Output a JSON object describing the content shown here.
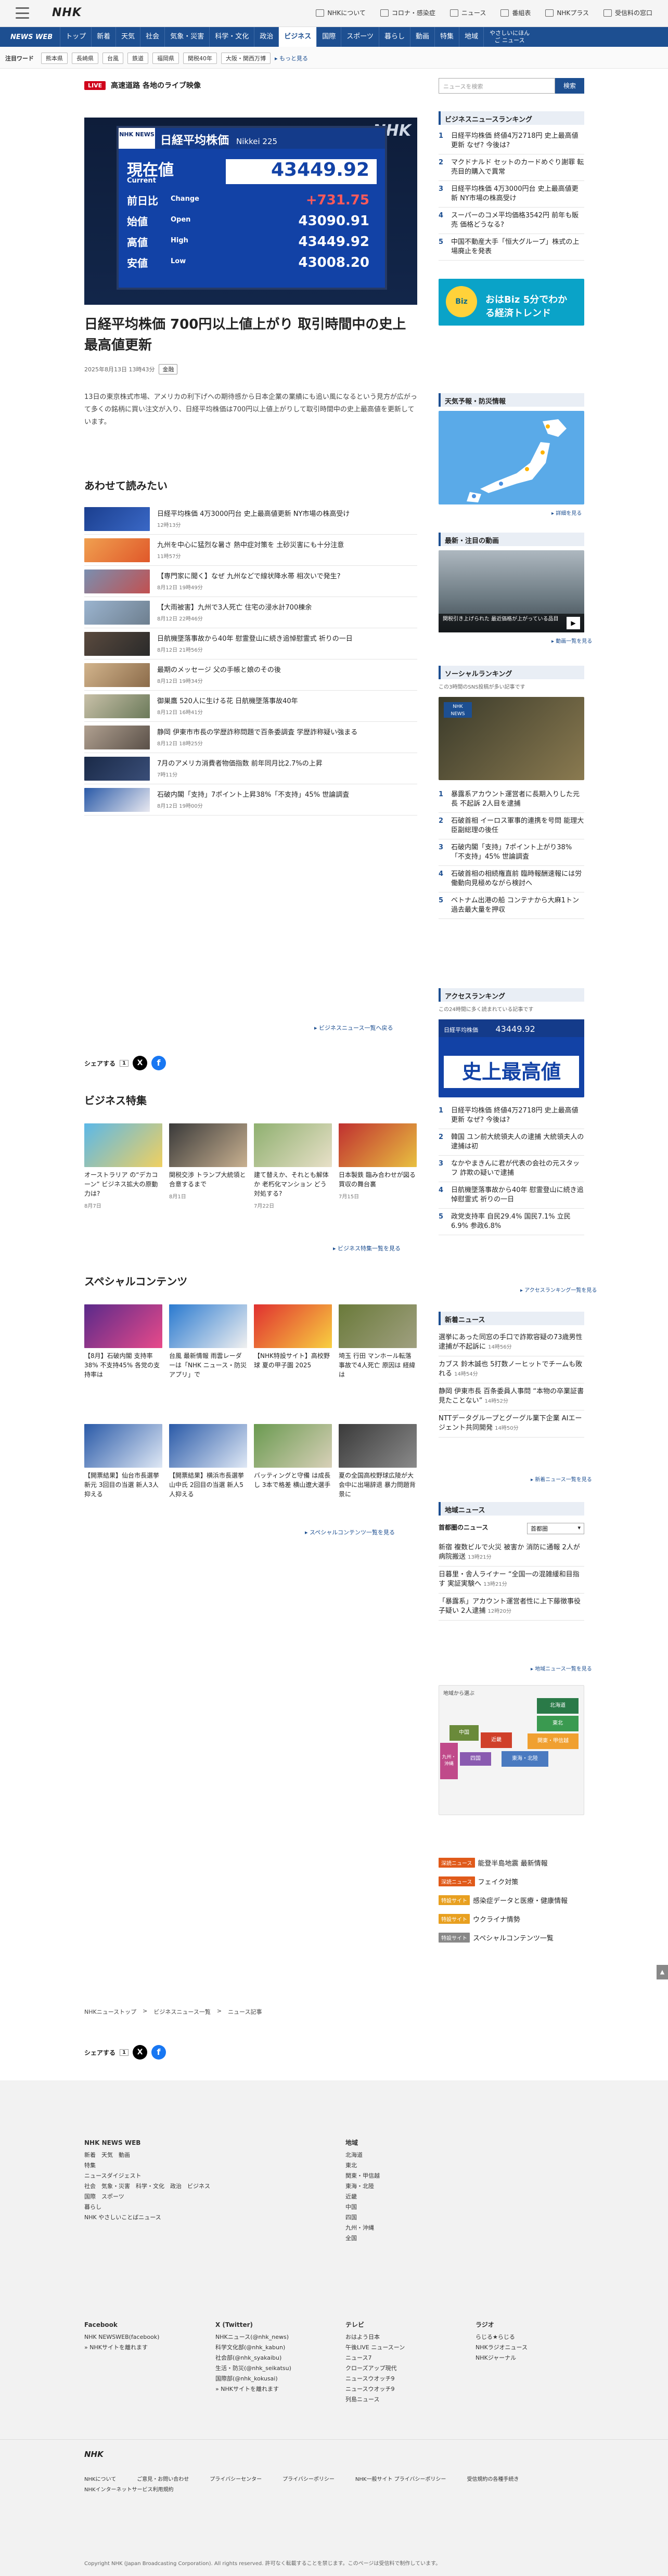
{
  "header": {
    "logo": "NHK",
    "links": [
      "NHKについて",
      "コロナ・感染症",
      "ニュース",
      "番組表",
      "NHKプラス",
      "受信料の窓口"
    ]
  },
  "nav": {
    "brand": "NEWS WEB",
    "items": [
      "トップ",
      "新着",
      "天気",
      "社会",
      "気象・災害",
      "科学・文化",
      "政治",
      "ビジネス",
      "国際",
      "スポーツ",
      "暮らし",
      "動画",
      "特集",
      "地域"
    ],
    "easy": "やさしいにほんご ニュース",
    "active": "ビジネス"
  },
  "attention": {
    "label": "注目ワード",
    "chips": [
      "熊本県",
      "長崎県",
      "台風",
      "鉄道",
      "福岡県",
      "関税40年",
      "大阪・関西万博"
    ],
    "more": "▸ もっと見る"
  },
  "live": {
    "badge": "LIVE",
    "text": "高速道路 各地のライブ映像"
  },
  "hero": {
    "box": "NHK NEWS",
    "title": "日経平均株価",
    "subtitle": "Nikkei 225",
    "watermark": "NHK",
    "rows": [
      {
        "ja": "現在値",
        "en": "Current",
        "val": "43449.92"
      },
      {
        "ja": "前日比",
        "en": "Change",
        "val": "+731.75"
      },
      {
        "ja": "始値",
        "en": "Open",
        "val": "43090.91"
      },
      {
        "ja": "高値",
        "en": "High",
        "val": "43449.92"
      },
      {
        "ja": "安値",
        "en": "Low",
        "val": "43008.20"
      }
    ]
  },
  "article": {
    "headline": "日経平均株価 700円以上値上がり 取引時間中の史上最高値更新",
    "date": "2025年8月13日 13時43分",
    "tag": "金融",
    "lead": "13日の東京株式市場、アメリカの利下げへの期待感から日本企業の業績にも追い風になるという見方が広がって多くの銘柄に買い注文が入り、日経平均株価は700円以上値上がりして取引時間中の史上最高値を更新しています。"
  },
  "related": {
    "title": "あわせて読みたい",
    "items": [
      {
        "t": "日経平均株価 4万3000円台 史上最高値更新 NY市場の株高受け",
        "d": "12時13分"
      },
      {
        "t": "九州を中心に猛烈な暑さ 熱中症対策を 土砂災害にも十分注意",
        "d": "11時57分"
      },
      {
        "t": "【専門家に聞く】なぜ 九州などで線状降水帯 相次いで発生?",
        "d": "8月12日 19時49分"
      },
      {
        "t": "【大雨被害】九州で3人死亡 住宅の浸水計700棟余",
        "d": "8月12日 22時46分"
      },
      {
        "t": "日航機墜落事故から40年 慰霊登山に続き追悼慰霊式 祈りの一日",
        "d": "8月12日 21時56分"
      },
      {
        "t": "最期のメッセージ 父の手帳と娘のその後",
        "d": "8月12日 19時34分"
      },
      {
        "t": "御巣鷹 520人に生ける花 日航機墜落事故40年",
        "d": "8月12日 16時41分"
      },
      {
        "t": "静岡 伊東市市長の学歴詐称問題で百条委調査 学歴詐称疑い強まる",
        "d": "8月12日 18時25分"
      },
      {
        "t": "7月のアメリカ消費者物価指数 前年同月比2.7%の上昇",
        "d": "7時11分"
      },
      {
        "t": "石破内閣「支持」7ポイント上昇38%「不支持」45% 世論調査",
        "d": "8月12日 19時00分"
      }
    ],
    "more": "▸ ビジネスニュース一覧へ戻る"
  },
  "share": {
    "label": "シェアする",
    "count": "1"
  },
  "feature": {
    "title": "ビジネス特集",
    "items": [
      {
        "t": "オーストラリア の“デカコーン” ビジネス拡大の原動力は?",
        "d": "8月7日"
      },
      {
        "t": "関税交渉 トランプ大統領と合意するまで",
        "d": "8月1日"
      },
      {
        "t": "建て替えか、それとも解体か 老朽化マンション どう対処する?",
        "d": "7月22日"
      },
      {
        "t": "日本製鉄 臨み合わせが図る買収の舞台裏",
        "d": "7月15日"
      }
    ],
    "more": "▸ ビジネス特集一覧を見る"
  },
  "special": {
    "title": "スペシャルコンテンツ",
    "items": [
      {
        "t": "【8月】石破内閣 支持率38% 不支持45% 各党の支持率は"
      },
      {
        "t": "台風 最新情報 雨雲レーダーは「NHK ニュース・防災アプリ」で"
      },
      {
        "t": "【NHK特設サイト】高校野球 夏の甲子園 2025"
      },
      {
        "t": "埼玉 行田 マンホール転落事故で4人死亡 原因は 経緯は"
      },
      {
        "t": "【開票結果】仙台市長選挙 新元 3回目の当選 新人3人抑える"
      },
      {
        "t": "【開票結果】横浜市長選挙 山中氏 2回目の当選 新人5人抑える"
      },
      {
        "t": "バッティングと守備 は成長し 3本で格差 横山遼大選手"
      },
      {
        "t": "夏の全国高校野球広陵が大会中に出場辞退 暴力問題背景に"
      }
    ],
    "more": "▸ スペシャルコンテンツ一覧を見る"
  },
  "search": {
    "placeholder": "ニュースを検索",
    "button": "検索"
  },
  "sidebar": {
    "ranking_title": "ビジネスニュースランキング",
    "ranking": [
      "日経平均株価 終値4万2718円 史上最高値更新 なぜ? 今後は?",
      "マクドナルド セットのカードめぐり謝罪 転売目的購入で異常",
      "日経平均株価 4万3000円台 史上最高値更新 NY市場の株高受け",
      "スーパーのコメ平均価格3542円 前年も販売 価格どうなる?",
      "中国不動産大手「恒大グループ」株式の上場廃止を発表"
    ],
    "biz_banner": "おはBiz 5分でわかる経済トレンド",
    "weather_title": "天気予報・防災情報",
    "weather_more": "▸ 詳細を見る",
    "video_title": "最新・注目の動画",
    "video_caption": "関税引き上げられた 最近価格が上がっている品目",
    "video_more": "▸ 動画一覧を見る",
    "social_title": "ソーシャルランキング",
    "social_sub": "この3時間のSNS投稿が多い記事です",
    "social": [
      "暴露系アカウント運営者に長期入りした元長 不起訴 2人目を逮捕",
      "石破首相 イーロス軍事的連携を号問 能理大臣副総理の後任",
      "石破内閣「支持」7ポイント上がり38% 「不支持」45% 世論調査",
      "石破首相の相続権直前 臨時報酬速報には労働動向見極めながら検討へ",
      "ベトナム出港の船 コンテナから大麻1トン 過去最大量を押収"
    ],
    "access_title": "アクセスランキング",
    "access_sub": "この24時間に多く読まれている記事です",
    "access_banner": "史上最高値",
    "access": [
      "日経平均株価 終値4万2718円 史上最高値更新 なぜ? 今後は?",
      "韓国 ユン前大統領夫人の逮捕 大統領夫人の逮捕は初",
      "なかやまきんに君が代表の会社の元スタッフ 詐欺の疑いで逮捕",
      "日航機墜落事故から40年 慰霊登山に続き追悼慰霊式 祈りの一日",
      "政党支持率 自民29.4% 国民7.1% 立民6.9% 参政6.8%"
    ],
    "access_more": "▸ アクセスランキング一覧を見る",
    "new_title": "新着ニュース",
    "new": [
      {
        "t": "選挙にあった同窓の手口で詐欺容疑の73歳男性 逮捕が不起訴に",
        "d": "14時56分"
      },
      {
        "t": "カブス 鈴木誠也 5打数ノーヒットでチームも敗れる",
        "d": "14時54分"
      },
      {
        "t": "静岡 伊東市長 百条委員人事問 “本物の卒業証書見たことない”",
        "d": "14時52分"
      },
      {
        "t": "NTTデータグループとグーグル業下企業 AIエージェント共同開発",
        "d": "14時50分"
      }
    ],
    "new_more": "▸ 新着ニュース一覧を見る",
    "local_title": "地域ニュース",
    "local_area": "首都圏のニュース",
    "local_select": "首都圏",
    "local": [
      {
        "t": "新宿 複数ビルで火災 被害か 消防に通報 2人が病院搬送",
        "d": "13時21分"
      },
      {
        "t": "日暮里・舎人ライナー “全国一の混雑緩和目指す 実証実験へ",
        "d": "13時21分"
      },
      {
        "t": "「暴露系」アカウント運営者性に上下藤徴事役子疑い 2人逮捕",
        "d": "12時20分"
      }
    ],
    "local_more": "▸ 地域ニュース一覧を見る",
    "map_label": "地域から選ぶ",
    "map_areas": [
      "北海道",
      "東北",
      "関東・甲信越",
      "東海・北陸",
      "近畿",
      "中国",
      "四国",
      "九州・沖縄"
    ],
    "special_links": [
      {
        "lbl": "深読ニュース",
        "t": "能登半島地震 最新情報"
      },
      {
        "lbl": "深読ニュース",
        "t": "フェイク対策"
      },
      {
        "lbl": "特設サイト",
        "t": "感染症データと医療・健康情報"
      },
      {
        "lbl": "特設サイト",
        "t": "ウクライナ情勢"
      },
      {
        "lbl": "特設サイト",
        "t": "スペシャルコンテンツ一覧"
      }
    ]
  },
  "breadcrumb": [
    "NHKニューストップ",
    "ビジネスニュース一覧",
    "ニュース記事"
  ],
  "footer": {
    "logo": "NHK",
    "news_web": {
      "title": "NHK NEWS WEB",
      "links": [
        "新着",
        "天気",
        "動画",
        "特集",
        "ニュースダイジェスト",
        "社会",
        "気象・災害",
        "科学・文化",
        "政治",
        "ビジネス",
        "国際",
        "スポーツ",
        "暮らし",
        "NHK やさしいことばニュース"
      ]
    },
    "regions_title": "地域",
    "regions": [
      "北海道",
      "東北",
      "関東・甲信越",
      "東海・北陸",
      "近畿",
      "中国",
      "四国",
      "九州・沖縄",
      "全国"
    ],
    "facebook": {
      "title": "Facebook",
      "links": [
        "NHK NEWSWEB(facebook)",
        "» NHKサイトを離れます"
      ]
    },
    "x": {
      "title": "X (Twitter)",
      "links": [
        "NHKニュース(@nhk_news)",
        "科学文化部(@nhk_kabun)",
        "社会部(@nhk_syakaibu)",
        "生活・防災(@nhk_seikatsu)",
        "国際部(@nhk_kokusai)",
        "» NHKサイトを離れます"
      ]
    },
    "tv": {
      "title": "テレビ",
      "links": [
        "おはよう日本",
        "午後LIVE ニュースーン",
        "ニュース7",
        "クローズアップ現代",
        "ニュースウオッチ9",
        "ニュースウオッチ9",
        "列島ニュース"
      ]
    },
    "radio": {
      "title": "ラジオ",
      "links": [
        "らじる★らじる",
        "NHKラジオニュース",
        "NHKジャーナル"
      ]
    },
    "bottom_links": [
      "NHKについて",
      "ご意見・お問い合わせ",
      "プライバシーセンター",
      "プライバシーポリシー",
      "NHK一般サイト プライバシーポリシー",
      "受信規約の各種手続き",
      "NHKインターネットサービス利用規約"
    ],
    "copyright": "Copyright NHK (Japan Broadcasting Corporation). All rights reserved. 許可なく転載することを禁じます。このページは受信料で制作しています。"
  },
  "colors": {
    "brand_blue": "#1d4f91",
    "live_red": "#d0021b",
    "up_red": "#ff5a5a"
  }
}
